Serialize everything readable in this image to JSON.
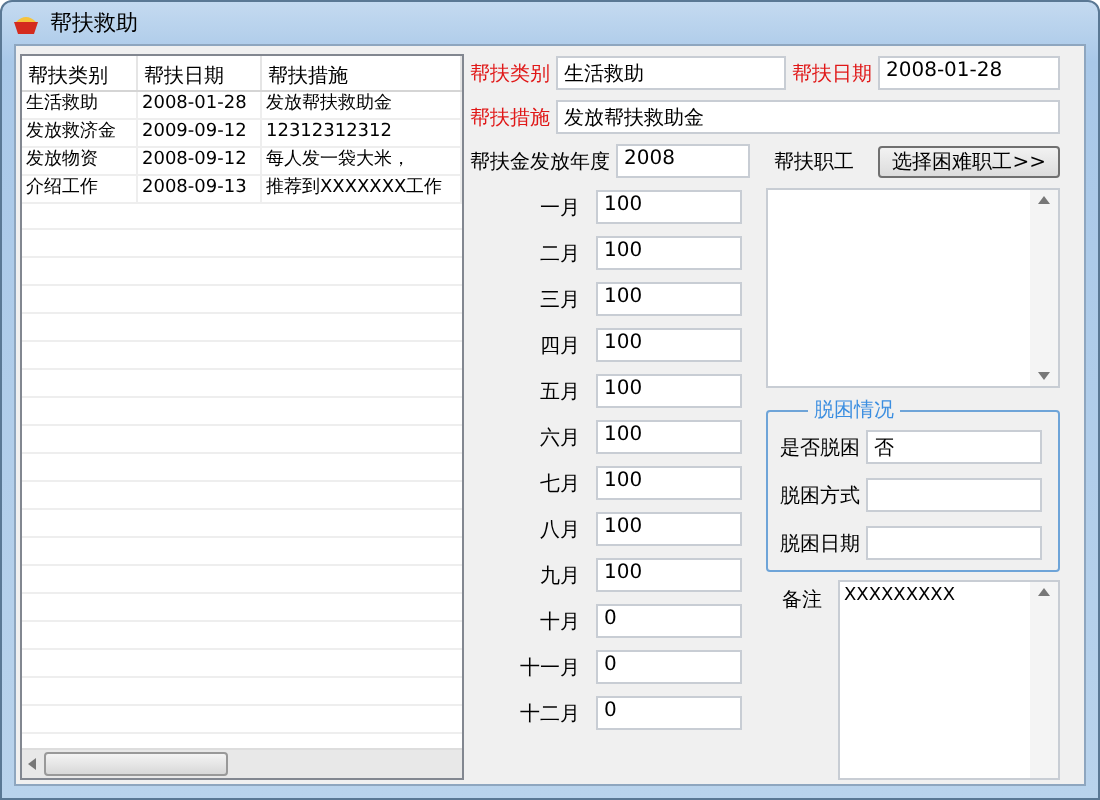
{
  "window": {
    "title": "帮扶救助"
  },
  "list": {
    "columns": [
      "帮扶类别",
      "帮扶日期",
      "帮扶措施"
    ],
    "rows": [
      [
        "生活救助",
        "2008-01-28",
        "发放帮扶救助金"
      ],
      [
        "发放救济金",
        "2009-09-12",
        "12312312312"
      ],
      [
        "发放物资",
        "2008-09-12",
        "每人发一袋大米，"
      ],
      [
        "介绍工作",
        "2008-09-13",
        "推荐到XXXXXXX工作"
      ]
    ]
  },
  "form": {
    "type_label": "帮扶类别",
    "type": "生活救助",
    "date_label": "帮扶日期",
    "date": "2008-01-28",
    "measure_label": "帮扶措施",
    "measure": "发放帮扶救助金",
    "year_label": "帮扶金发放年度",
    "year": "2008",
    "months": [
      {
        "label": "一月",
        "value": "100"
      },
      {
        "label": "二月",
        "value": "100"
      },
      {
        "label": "三月",
        "value": "100"
      },
      {
        "label": "四月",
        "value": "100"
      },
      {
        "label": "五月",
        "value": "100"
      },
      {
        "label": "六月",
        "value": "100"
      },
      {
        "label": "七月",
        "value": "100"
      },
      {
        "label": "八月",
        "value": "100"
      },
      {
        "label": "九月",
        "value": "100"
      },
      {
        "label": "十月",
        "value": "0"
      },
      {
        "label": "十一月",
        "value": "0"
      },
      {
        "label": "十二月",
        "value": "0"
      }
    ],
    "staff_label": "帮扶职工",
    "select_button": "选择困难职工>>",
    "poverty_group": {
      "title": "脱困情况",
      "fields": [
        {
          "label": "是否脱困",
          "value": "否"
        },
        {
          "label": "脱困方式"
        },
        {
          "label": "脱困日期"
        }
      ]
    },
    "remarks_label": "备注",
    "remarks": "XXXXXXXXX"
  }
}
